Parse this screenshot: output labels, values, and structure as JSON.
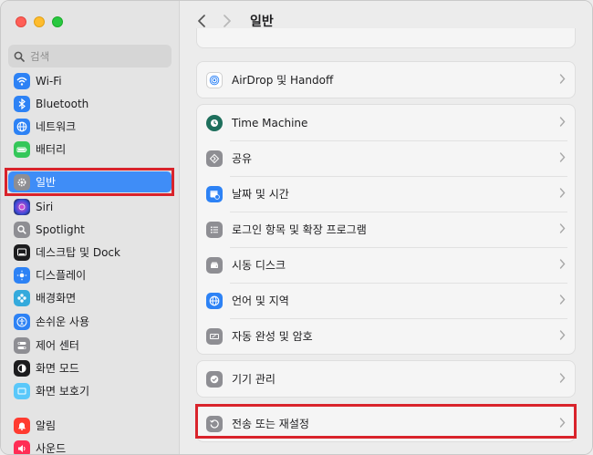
{
  "search": {
    "placeholder": "검색"
  },
  "sidebar": {
    "items": [
      {
        "label": "Wi-Fi",
        "icon": "wifi-icon",
        "color": "#2d82f5"
      },
      {
        "label": "Bluetooth",
        "icon": "bluetooth-icon",
        "color": "#2d82f5"
      },
      {
        "label": "네트워크",
        "icon": "globe-icon",
        "color": "#2d82f5"
      },
      {
        "label": "배터리",
        "icon": "battery-icon",
        "color": "#34c759"
      },
      {
        "label": "일반",
        "icon": "gear-icon",
        "color": "#8e8e93",
        "selected": true
      },
      {
        "label": "Siri",
        "icon": "siri-icon",
        "color": "#5b3cc4"
      },
      {
        "label": "Spotlight",
        "icon": "magnifier-icon",
        "color": "#8e8e93"
      },
      {
        "label": "데스크탑 및 Dock",
        "icon": "dock-icon",
        "color": "#1c1c1e"
      },
      {
        "label": "디스플레이",
        "icon": "sun-icon",
        "color": "#2d82f5"
      },
      {
        "label": "배경화면",
        "icon": "flower-icon",
        "color": "#34aadc"
      },
      {
        "label": "손쉬운 사용",
        "icon": "accessibility-icon",
        "color": "#2d82f5"
      },
      {
        "label": "제어 센터",
        "icon": "toggles-icon",
        "color": "#8e8e93"
      },
      {
        "label": "화면 모드",
        "icon": "appearance-icon",
        "color": "#1c1c1e"
      },
      {
        "label": "화면 보호기",
        "icon": "screensaver-icon",
        "color": "#5ac8fa"
      },
      {
        "label": "알림",
        "icon": "bell-icon",
        "color": "#ff3b30"
      },
      {
        "label": "사운드",
        "icon": "speaker-icon",
        "color": "#ff2d55"
      }
    ]
  },
  "toolbar": {
    "title": "일반",
    "back_icon": "chevron-left-icon",
    "forward_icon": "chevron-right-icon"
  },
  "groups": [
    {
      "rows": [
        {
          "label": "AirDrop 및 Handoff",
          "icon": "airdrop-icon",
          "color": "#ffffff"
        }
      ]
    },
    {
      "rows": [
        {
          "label": "Time Machine",
          "icon": "time-machine-icon",
          "color": "#1e6f5c"
        },
        {
          "label": "공유",
          "icon": "sharing-icon",
          "color": "#8e8e93"
        },
        {
          "label": "날짜 및 시간",
          "icon": "calendar-clock-icon",
          "color": "#2d82f5"
        },
        {
          "label": "로그인 항목 및 확장 프로그램",
          "icon": "list-icon",
          "color": "#8e8e93"
        },
        {
          "label": "시동 디스크",
          "icon": "disk-icon",
          "color": "#8e8e93"
        },
        {
          "label": "언어 및 지역",
          "icon": "globe-icon",
          "color": "#2d82f5"
        },
        {
          "label": "자동 완성 및 암호",
          "icon": "keyboard-icon",
          "color": "#8e8e93"
        }
      ]
    },
    {
      "rows": [
        {
          "label": "기기 관리",
          "icon": "checkmark-gear-icon",
          "color": "#8e8e93"
        }
      ]
    },
    {
      "rows": [
        {
          "label": "전송 또는 재설정",
          "icon": "reset-icon",
          "color": "#8e8e93"
        }
      ]
    }
  ],
  "highlight_color": "#d9232b"
}
